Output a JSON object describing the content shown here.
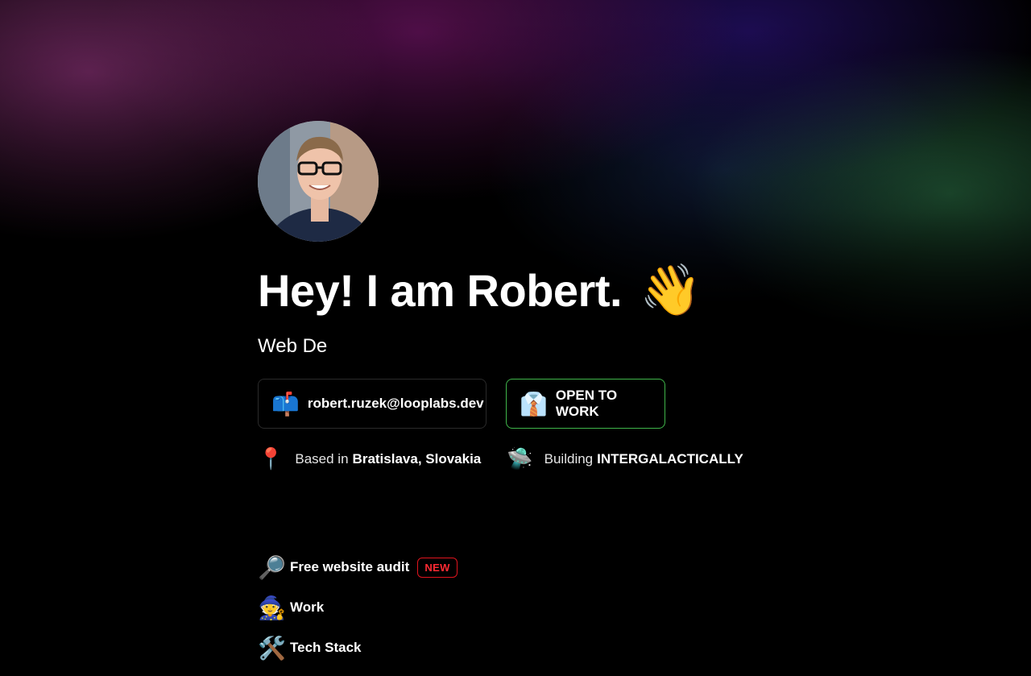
{
  "profile": {
    "greeting": "Hey! I am Robert.",
    "greeting_emoji": "👋",
    "subtitle": "Web De"
  },
  "contact": {
    "email_icon": "📫",
    "email": "robert.ruzek@looplabs.dev",
    "status_icon": "👔",
    "status": "OPEN TO WORK"
  },
  "meta": {
    "location_icon": "📍",
    "location_prefix": "Based in",
    "location": "Bratislava, Slovakia",
    "building_icon": "🛸",
    "building_prefix": "Building",
    "building": "INTERGALACTICALLY"
  },
  "menu": [
    {
      "icon": "🔎",
      "label": "Free website audit",
      "badge": "NEW"
    },
    {
      "icon": "🧙",
      "label": "Work"
    },
    {
      "icon": "🛠️",
      "label": "Tech Stack"
    }
  ],
  "colors": {
    "accent_green": "#3fb54a",
    "badge_red": "#e0141e"
  }
}
